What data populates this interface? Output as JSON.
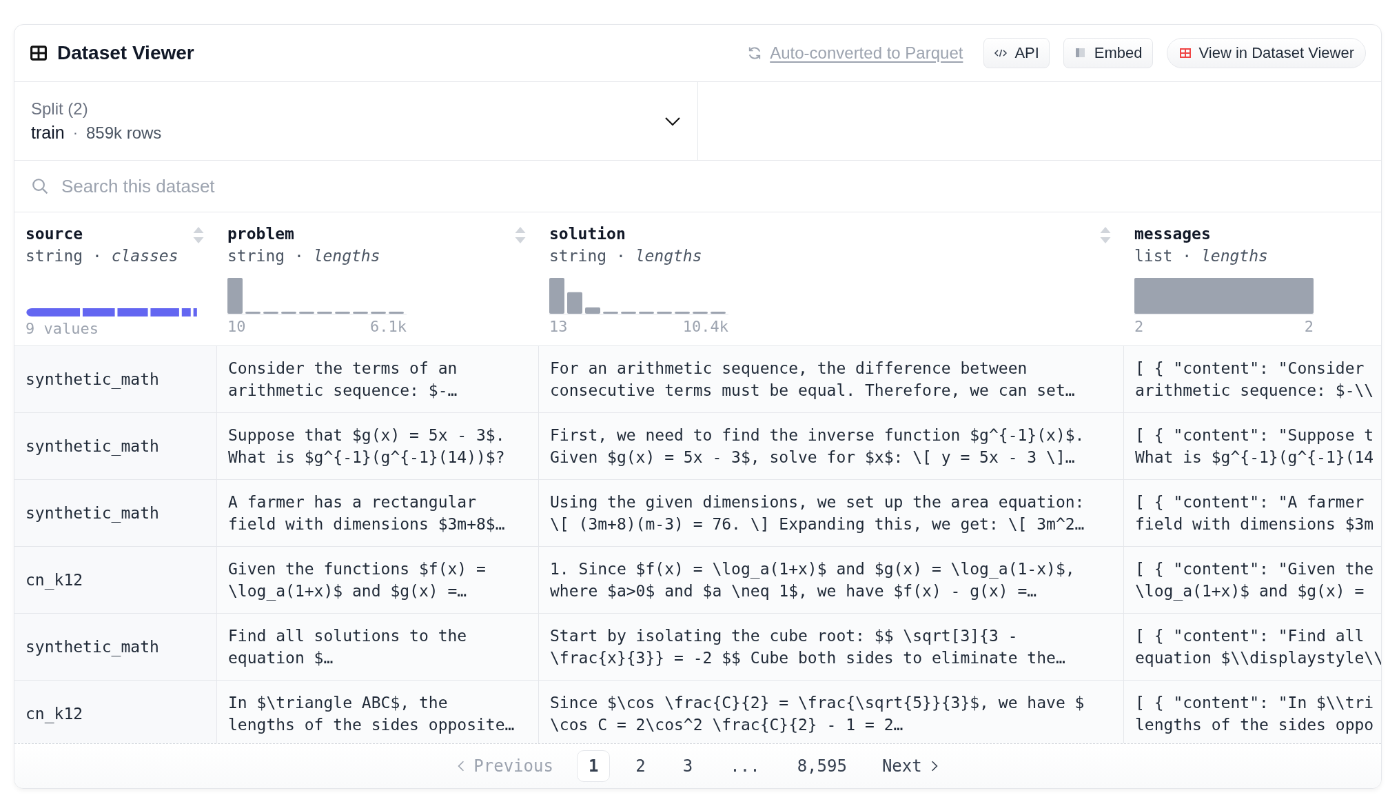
{
  "header": {
    "title": "Dataset Viewer",
    "parquet_link": "Auto-converted to Parquet",
    "buttons": [
      {
        "kind": "api",
        "label": "API"
      },
      {
        "kind": "embed",
        "label": "Embed"
      },
      {
        "kind": "viewer",
        "label": "View in Dataset Viewer"
      }
    ]
  },
  "split": {
    "label": "Split (2)",
    "name": "train",
    "separator": "·",
    "rows": "859k rows"
  },
  "search": {
    "placeholder": "Search this dataset"
  },
  "columns": [
    {
      "name": "source",
      "type": "string · *classes*",
      "kind": "classes",
      "sortable": true,
      "min": "9 values"
    },
    {
      "name": "problem",
      "type": "string · *lengths*",
      "kind": "hist",
      "sortable": true,
      "min": "10",
      "max": "6.1k"
    },
    {
      "name": "solution",
      "type": "string · *lengths*",
      "kind": "hist",
      "sortable": true,
      "min": "13",
      "max": "10.4k"
    },
    {
      "name": "messages",
      "type": "list · *lengths*",
      "kind": "hist",
      "sortable": false,
      "min": "2",
      "max": "2"
    }
  ],
  "rows": [
    [
      "synthetic_math",
      "Consider the terms of an\narithmetic sequence: $-…",
      "For an arithmetic sequence, the difference between\nconsecutive terms must be equal. Therefore, we can set…",
      "[ { \"content\": \"Consider\narithmetic sequence: $-\\\\"
    ],
    [
      "synthetic_math",
      "Suppose that $g(x) = 5x - 3$.\nWhat is $g^{-1}(g^{-1}(14))$?",
      "First, we need to find the inverse function $g^{-1}(x)$.\nGiven $g(x) = 5x - 3$, solve for $x$: \\[ y = 5x - 3 \\]…",
      "[ { \"content\": \"Suppose t\nWhat is $g^{-1}(g^{-1}(14"
    ],
    [
      "synthetic_math",
      "A farmer has a rectangular\nfield with dimensions $3m+8$…",
      "Using the given dimensions, we set up the area equation:\n\\[ (3m+8)(m-3) = 76. \\] Expanding this, we get: \\[ 3m^2…",
      "[ { \"content\": \"A farmer\nfield with dimensions $3m"
    ],
    [
      "cn_k12",
      "Given the functions $f(x) =\n\\log_a(1+x)$ and $g(x) =…",
      "1. Since $f(x) = \\log_a(1+x)$ and $g(x) = \\log_a(1-x)$,\nwhere $a>0$ and $a \\neq 1$, we have $f(x) - g(x) =…",
      "[ { \"content\": \"Given the\n\\log_a(1+x)$ and $g(x) ="
    ],
    [
      "synthetic_math",
      "Find all solutions to the\nequation $…",
      "Start by isolating the cube root: $$ \\sqrt[3]{3 -\n\\frac{x}{3}} = -2 $$ Cube both sides to eliminate the…",
      "[ { \"content\": \"Find all\nequation $\\\\displaystyle\\\\"
    ],
    [
      "cn_k12",
      "In $\\triangle ABC$, the\nlengths of the sides opposite…",
      "Since $\\cos \\frac{C}{2} = \\frac{\\sqrt{5}}{3}$, we have $\n\\cos C = 2\\cos^2 \\frac{C}{2} - 1 = 2…",
      "[ { \"content\": \"In $\\\\tri\nlengths of the sides oppo"
    ]
  ],
  "pagination": {
    "previous": {
      "label": "Previous",
      "disabled": true
    },
    "pages": [
      {
        "label": "1",
        "selected": true
      },
      {
        "label": "2",
        "selected": false
      },
      {
        "label": "3",
        "selected": false
      },
      {
        "label": "...",
        "selected": false
      },
      {
        "label": "8,595",
        "selected": false
      }
    ],
    "next": {
      "label": "Next",
      "disabled": false
    }
  }
}
